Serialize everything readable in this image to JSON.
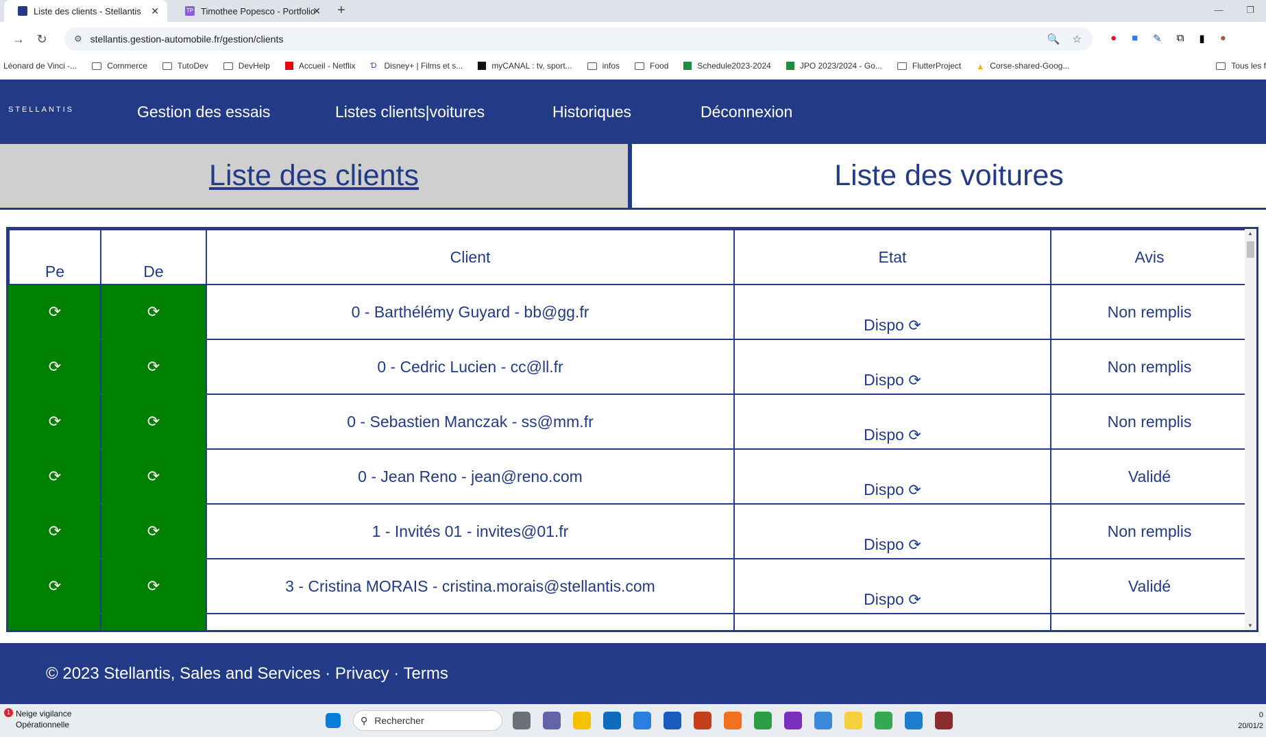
{
  "browser": {
    "tabs": [
      {
        "title": "Liste des clients - Stellantis",
        "active": true
      },
      {
        "title": "Timothee Popesco - Portfolio",
        "active": false
      }
    ],
    "url": "stellantis.gestion-automobile.fr/gestion/clients",
    "bookmarks": [
      "Léonard de Vinci -...",
      "Commerce",
      "TutoDev",
      "DevHelp",
      "Accueil - Netflix",
      "Disney+ | Films et s...",
      "myCANAL : tv, sport...",
      "infos",
      "Food",
      "Schedule2023-2024",
      "JPO 2023/2024 - Go...",
      "FlutterProject",
      "Corse-shared-Goog..."
    ],
    "bookmarks_all": "Tous les f"
  },
  "nav": {
    "logo": "STELLANTIS",
    "links": [
      "Gestion des essais",
      "Listes clients|voitures",
      "Historiques",
      "Déconnexion"
    ]
  },
  "subtabs": {
    "clients": "Liste des clients",
    "cars": "Liste des voitures"
  },
  "table": {
    "headers": {
      "pe": "Pe",
      "de": "De",
      "client": "Client",
      "etat": "Etat",
      "avis": "Avis"
    },
    "rows": [
      {
        "client": "0 - Barthélémy Guyard - bb@gg.fr",
        "etat": "Dispo",
        "avis": "Non remplis"
      },
      {
        "client": "0 - Cedric Lucien - cc@ll.fr",
        "etat": "Dispo",
        "avis": "Non remplis"
      },
      {
        "client": "0 - Sebastien Manczak - ss@mm.fr",
        "etat": "Dispo",
        "avis": "Non remplis"
      },
      {
        "client": "0 - Jean Reno - jean@reno.com",
        "etat": "Dispo",
        "avis": "Validé"
      },
      {
        "client": "1 - Invités 01 - invites@01.fr",
        "etat": "Dispo",
        "avis": "Non remplis"
      },
      {
        "client": "3 - Cristina MORAIS - cristina.morais@stellantis.com",
        "etat": "Dispo",
        "avis": "Validé"
      }
    ]
  },
  "footer": {
    "copyright": "© 2023 Stellantis, Sales and Services · ",
    "privacy": "Privacy",
    "sep": " · ",
    "terms": "Terms"
  },
  "taskbar": {
    "weather_title": "Neige vigilance",
    "weather_sub": "Opérationnelle",
    "weather_badge": "1",
    "search_placeholder": "Rechercher",
    "clock_time": "0",
    "clock_date": "20/01/2"
  },
  "colors": {
    "brand": "#233a87",
    "green": "#008000"
  }
}
